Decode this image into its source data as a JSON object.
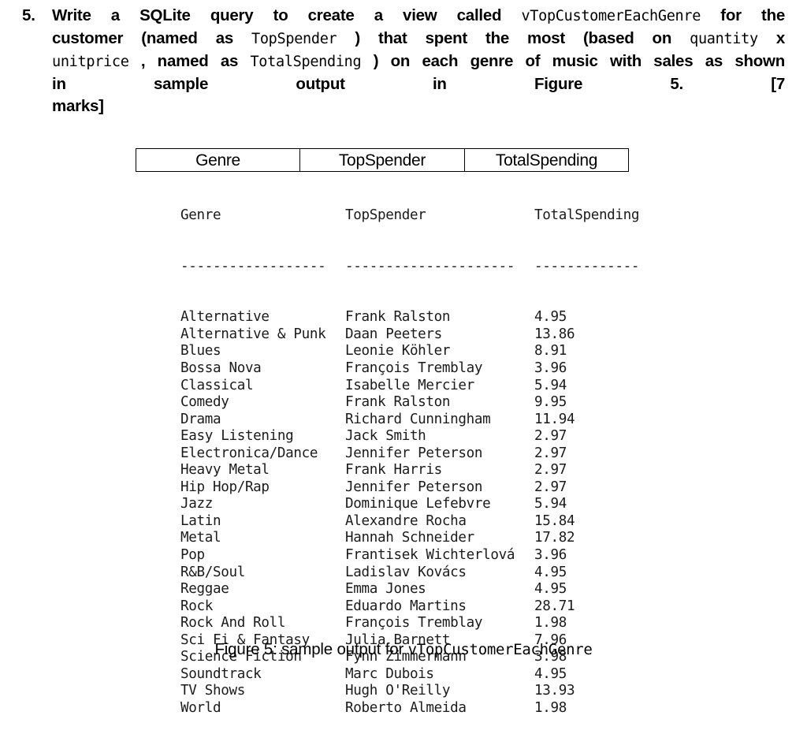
{
  "question": {
    "number": "5.",
    "lines": [
      [
        {
          "t": "text",
          "v": "Write a SQLite query to create a view called "
        },
        {
          "t": "code",
          "v": "vTopCustomerEachGenre"
        },
        {
          "t": "text",
          "v": " for the"
        }
      ],
      [
        {
          "t": "text",
          "v": "customer (named as "
        },
        {
          "t": "code",
          "v": "TopSpender"
        },
        {
          "t": "text",
          "v": ") that spent the most (based on "
        },
        {
          "t": "code",
          "v": "quantity"
        },
        {
          "t": "text",
          "v": " x"
        }
      ],
      [
        {
          "t": "code",
          "v": "unitprice"
        },
        {
          "t": "text",
          "v": ", named as "
        },
        {
          "t": "code",
          "v": "TotalSpending"
        },
        {
          "t": "text",
          "v": ") on each genre of music with sales as shown"
        }
      ],
      [
        {
          "t": "text",
          "v": "in sample output in Figure 5."
        },
        {
          "t": "text",
          "v": "[7"
        }
      ],
      [
        {
          "t": "text",
          "v": "marks]"
        }
      ]
    ],
    "marks_label": "[7",
    "marks_continuation": "marks]"
  },
  "header_table": {
    "columns": [
      "Genre",
      "TopSpender",
      "TotalSpending"
    ]
  },
  "cli": {
    "headers": [
      "Genre",
      "TopSpender",
      "TotalSpending"
    ],
    "separators": [
      "------------------",
      "---------------------",
      "-------------"
    ],
    "rows": [
      [
        "Alternative",
        "Frank Ralston",
        "4.95"
      ],
      [
        "Alternative & Punk",
        "Daan Peeters",
        "13.86"
      ],
      [
        "Blues",
        "Leonie Köhler",
        "8.91"
      ],
      [
        "Bossa Nova",
        "François Tremblay",
        "3.96"
      ],
      [
        "Classical",
        "Isabelle Mercier",
        "5.94"
      ],
      [
        "Comedy",
        "Frank Ralston",
        "9.95"
      ],
      [
        "Drama",
        "Richard Cunningham",
        "11.94"
      ],
      [
        "Easy Listening",
        "Jack Smith",
        "2.97"
      ],
      [
        "Electronica/Dance",
        "Jennifer Peterson",
        "2.97"
      ],
      [
        "Heavy Metal",
        "Frank Harris",
        "2.97"
      ],
      [
        "Hip Hop/Rap",
        "Jennifer Peterson",
        "2.97"
      ],
      [
        "Jazz",
        "Dominique Lefebvre",
        "5.94"
      ],
      [
        "Latin",
        "Alexandre Rocha",
        "15.84"
      ],
      [
        "Metal",
        "Hannah Schneider",
        "17.82"
      ],
      [
        "Pop",
        "Frantisek Wichterlová",
        "3.96"
      ],
      [
        "R&B/Soul",
        "Ladislav Kovács",
        "4.95"
      ],
      [
        "Reggae",
        "Emma Jones",
        "4.95"
      ],
      [
        "Rock",
        "Eduardo Martins",
        "28.71"
      ],
      [
        "Rock And Roll",
        "François Tremblay",
        "1.98"
      ],
      [
        "Sci Fi & Fantasy",
        "Julia Barnett",
        "7.96"
      ],
      [
        "Science Fiction",
        "Fynn Zimmermann",
        "3.98"
      ],
      [
        "Soundtrack",
        "Marc Dubois",
        "4.95"
      ],
      [
        "TV Shows",
        "Hugh O'Reilly",
        "13.93"
      ],
      [
        "World",
        "Roberto Almeida",
        "1.98"
      ]
    ]
  },
  "caption": {
    "prefix": "Figure 5: sample output for ",
    "view_name": "vTopCustomerEachGenre"
  },
  "colors": {
    "text": "#000000",
    "cli_text": "#1b1b1b",
    "border": "#000000",
    "background": "#ffffff"
  }
}
